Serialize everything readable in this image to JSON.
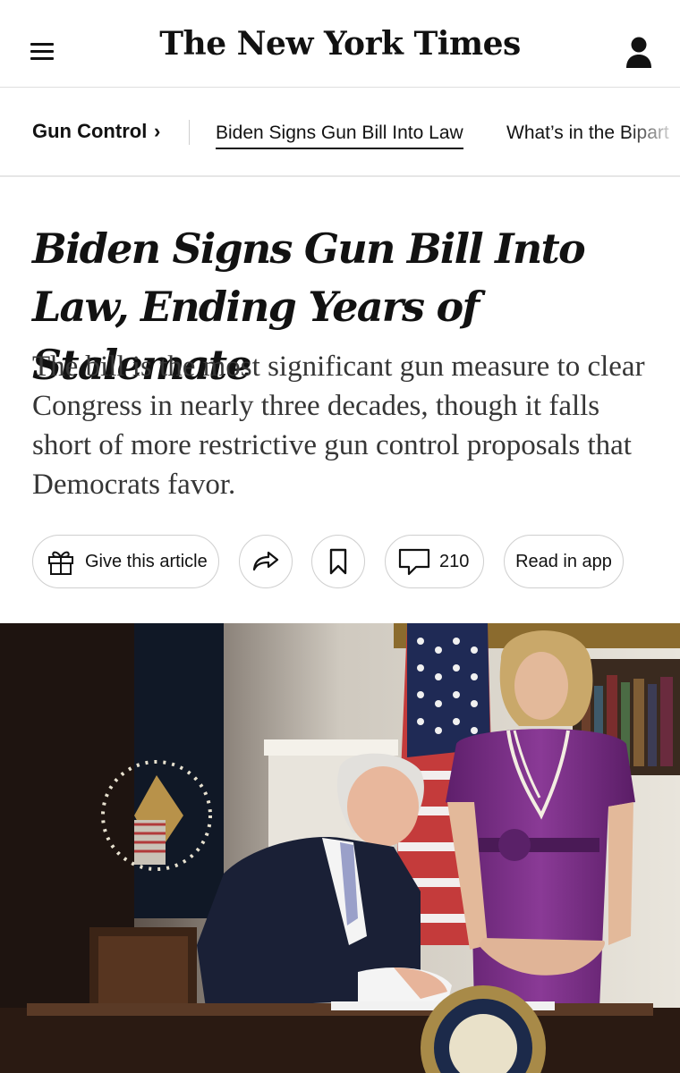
{
  "masthead": {
    "logo_text": "The New York Times",
    "menu_icon": "hamburger-menu-icon",
    "account_icon": "user-account-icon"
  },
  "section_nav": {
    "kicker": "Gun Control",
    "kicker_chevron": "›",
    "links": [
      {
        "label": "Biden Signs Gun Bill Into Law",
        "active": true
      },
      {
        "label": "What’s in the Bipart",
        "active": false
      }
    ]
  },
  "article": {
    "headline": "Biden Signs Gun Bill Into Law, Ending Years of Stalemate",
    "summary": "The bill is the most significant gun measure to clear Congress in nearly three decades, though it falls short of more restrictive gun control proposals that Democrats favor."
  },
  "actions": {
    "gift_label": "Give this article",
    "comments_count": "210",
    "read_in_app_label": "Read in app"
  },
  "colors": {
    "text": "#121212",
    "summary": "#363636",
    "border": "#cfcfcf",
    "dress": "#7b2f86"
  }
}
